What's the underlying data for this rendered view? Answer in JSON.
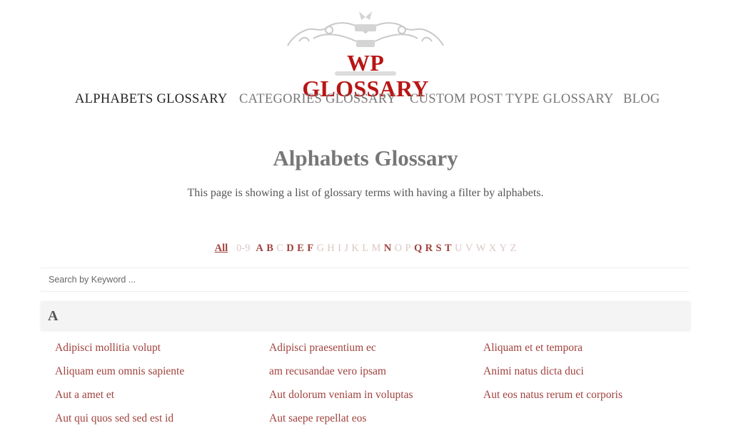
{
  "logo": {
    "text": "WP GLOSSARY",
    "colors": {
      "text": "#b81515",
      "ornament": "#cfcfcf"
    }
  },
  "nav": {
    "items": [
      {
        "label": "ALPHABETS GLOSSARY",
        "active": true
      },
      {
        "label": "CATEGORIES GLOSSARY",
        "active": false
      },
      {
        "label": "CUSTOM POST TYPE GLOSSARY",
        "active": false
      },
      {
        "label": "BLOG",
        "active": false
      }
    ]
  },
  "page": {
    "title": "Alphabets Glossary",
    "description": "This page is showing a list of glossary terms with having a filter by alphabets."
  },
  "alphabet_filter": {
    "all_label": "All",
    "numeric_label": "0-9",
    "letters": [
      {
        "label": "A",
        "enabled": true
      },
      {
        "label": "B",
        "enabled": true
      },
      {
        "label": "C",
        "enabled": false
      },
      {
        "label": "D",
        "enabled": true
      },
      {
        "label": "E",
        "enabled": true
      },
      {
        "label": "F",
        "enabled": true
      },
      {
        "label": "G",
        "enabled": false
      },
      {
        "label": "H",
        "enabled": false
      },
      {
        "label": "I",
        "enabled": false
      },
      {
        "label": "J",
        "enabled": false
      },
      {
        "label": "K",
        "enabled": false
      },
      {
        "label": "L",
        "enabled": false
      },
      {
        "label": "M",
        "enabled": false
      },
      {
        "label": "N",
        "enabled": true
      },
      {
        "label": "O",
        "enabled": false
      },
      {
        "label": "P",
        "enabled": false
      },
      {
        "label": "Q",
        "enabled": true
      },
      {
        "label": "R",
        "enabled": true
      },
      {
        "label": "S",
        "enabled": true
      },
      {
        "label": "T",
        "enabled": true
      },
      {
        "label": "U",
        "enabled": false
      },
      {
        "label": "V",
        "enabled": false
      },
      {
        "label": "W",
        "enabled": false
      },
      {
        "label": "X",
        "enabled": false
      },
      {
        "label": "Y",
        "enabled": false
      },
      {
        "label": "Z",
        "enabled": false
      }
    ],
    "colors": {
      "enabled": "#a0423d",
      "disabled": "#dcc6c4"
    }
  },
  "search": {
    "placeholder": "Search by Keyword ...",
    "value": ""
  },
  "section": {
    "letter": "A",
    "terms": [
      "Adipisci mollitia volupt",
      "Adipisci praesentium ec",
      "Aliquam et et tempora",
      "Aliquam eum omnis sapiente",
      "am recusandae vero ipsam",
      "Animi natus dicta duci",
      "Aut a amet et",
      "Aut dolorum veniam in voluptas",
      "Aut eos natus rerum et corporis",
      "Aut qui quos sed sed est id",
      "Aut saepe repellat eos"
    ]
  }
}
